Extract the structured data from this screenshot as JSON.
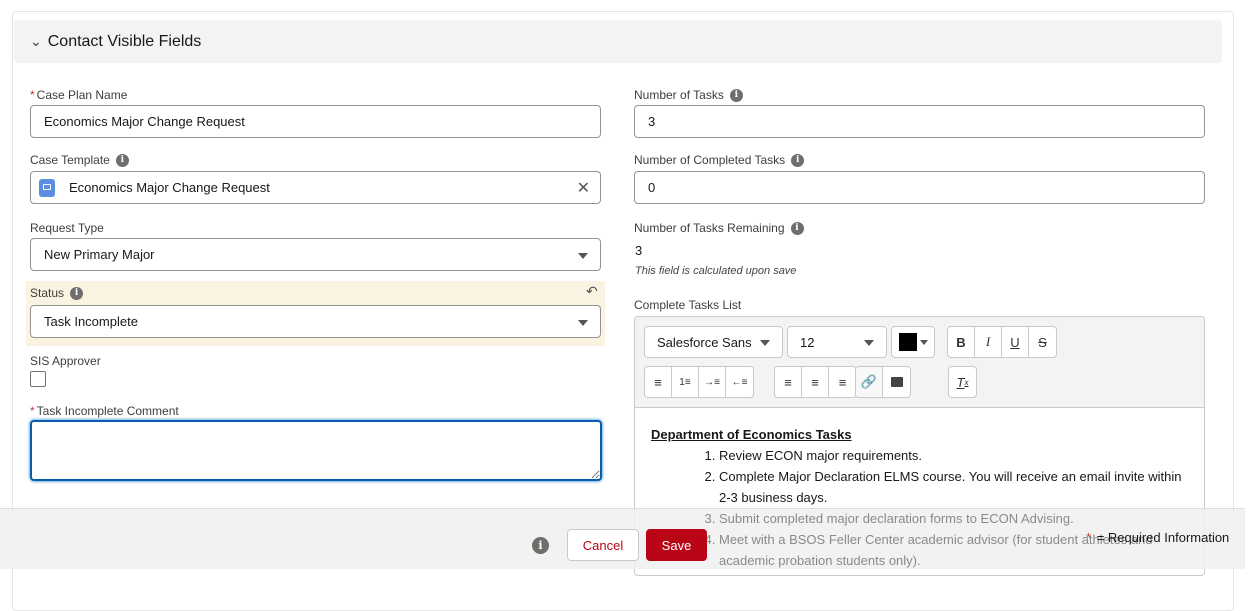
{
  "section": {
    "title": "Contact Visible Fields"
  },
  "left": {
    "case_plan_name": {
      "label": "Case Plan Name",
      "value": "Economics Major Change Request"
    },
    "case_template": {
      "label": "Case Template",
      "value": "Economics Major Change Request"
    },
    "request_type": {
      "label": "Request Type",
      "value": "New Primary Major"
    },
    "status": {
      "label": "Status",
      "value": "Task Incomplete"
    },
    "sis_approver": {
      "label": "SIS Approver",
      "checked": false
    },
    "task_incomplete_comment": {
      "label": "Task Incomplete Comment",
      "value": ""
    }
  },
  "right": {
    "number_of_tasks": {
      "label": "Number of Tasks",
      "value": "3"
    },
    "number_completed": {
      "label": "Number of Completed Tasks",
      "value": "0"
    },
    "number_remaining": {
      "label": "Number of Tasks Remaining",
      "value": "3",
      "help": "This field is calculated upon save"
    },
    "complete_tasks_list": {
      "label": "Complete Tasks List",
      "font": "Salesforce Sans",
      "size": "12",
      "color": "#000000",
      "heading": "Department of Economics Tasks",
      "items": [
        "Review ECON major requirements.",
        "Complete Major Declaration ELMS course. You will receive an email invite within 2-3 business days.",
        "Submit completed major declaration forms to ECON Advising.",
        "Meet with a BSOS Feller Center academic advisor (for student athletes and academic probation students only)."
      ]
    }
  },
  "footer": {
    "cancel": "Cancel",
    "save": "Save",
    "required_star": "*",
    "required_text": "= Required Information"
  },
  "colors": {
    "save": "#ba0517",
    "status_highlight": "#faf3e1",
    "focus": "#0b5cab"
  }
}
